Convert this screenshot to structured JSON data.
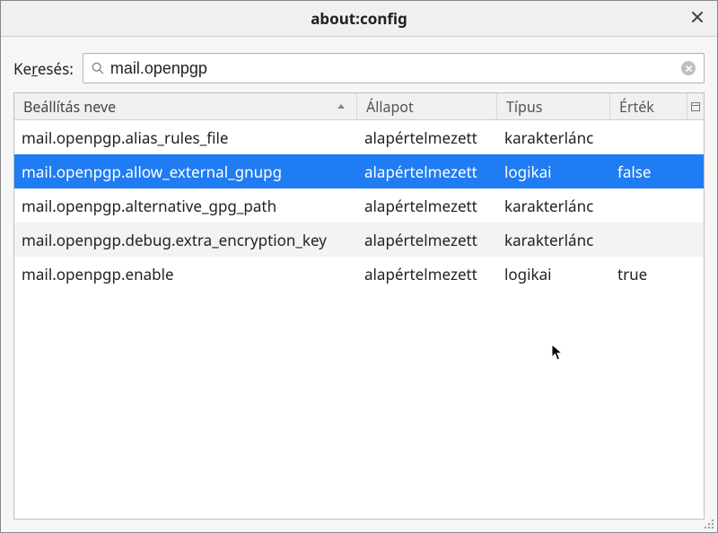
{
  "window": {
    "title": "about:config"
  },
  "search": {
    "label_pre": "Ke",
    "label_accesskey": "r",
    "label_post": "esés:",
    "value": "mail.openpgp",
    "placeholder": ""
  },
  "columns": {
    "name": "Beállítás neve",
    "status": "Állapot",
    "type": "Típus",
    "value": "Érték"
  },
  "rows": [
    {
      "name": "mail.openpgp.alias_rules_file",
      "status": "alapértelmezett",
      "type": "karakterlánc",
      "value": "",
      "selected": false,
      "alt": false
    },
    {
      "name": "mail.openpgp.allow_external_gnupg",
      "status": "alapértelmezett",
      "type": "logikai",
      "value": "false",
      "selected": true,
      "alt": false
    },
    {
      "name": "mail.openpgp.alternative_gpg_path",
      "status": "alapértelmezett",
      "type": "karakterlánc",
      "value": "",
      "selected": false,
      "alt": false
    },
    {
      "name": "mail.openpgp.debug.extra_encryption_key",
      "status": "alapértelmezett",
      "type": "karakterlánc",
      "value": "",
      "selected": false,
      "alt": true
    },
    {
      "name": "mail.openpgp.enable",
      "status": "alapértelmezett",
      "type": "logikai",
      "value": "true",
      "selected": false,
      "alt": false
    }
  ]
}
